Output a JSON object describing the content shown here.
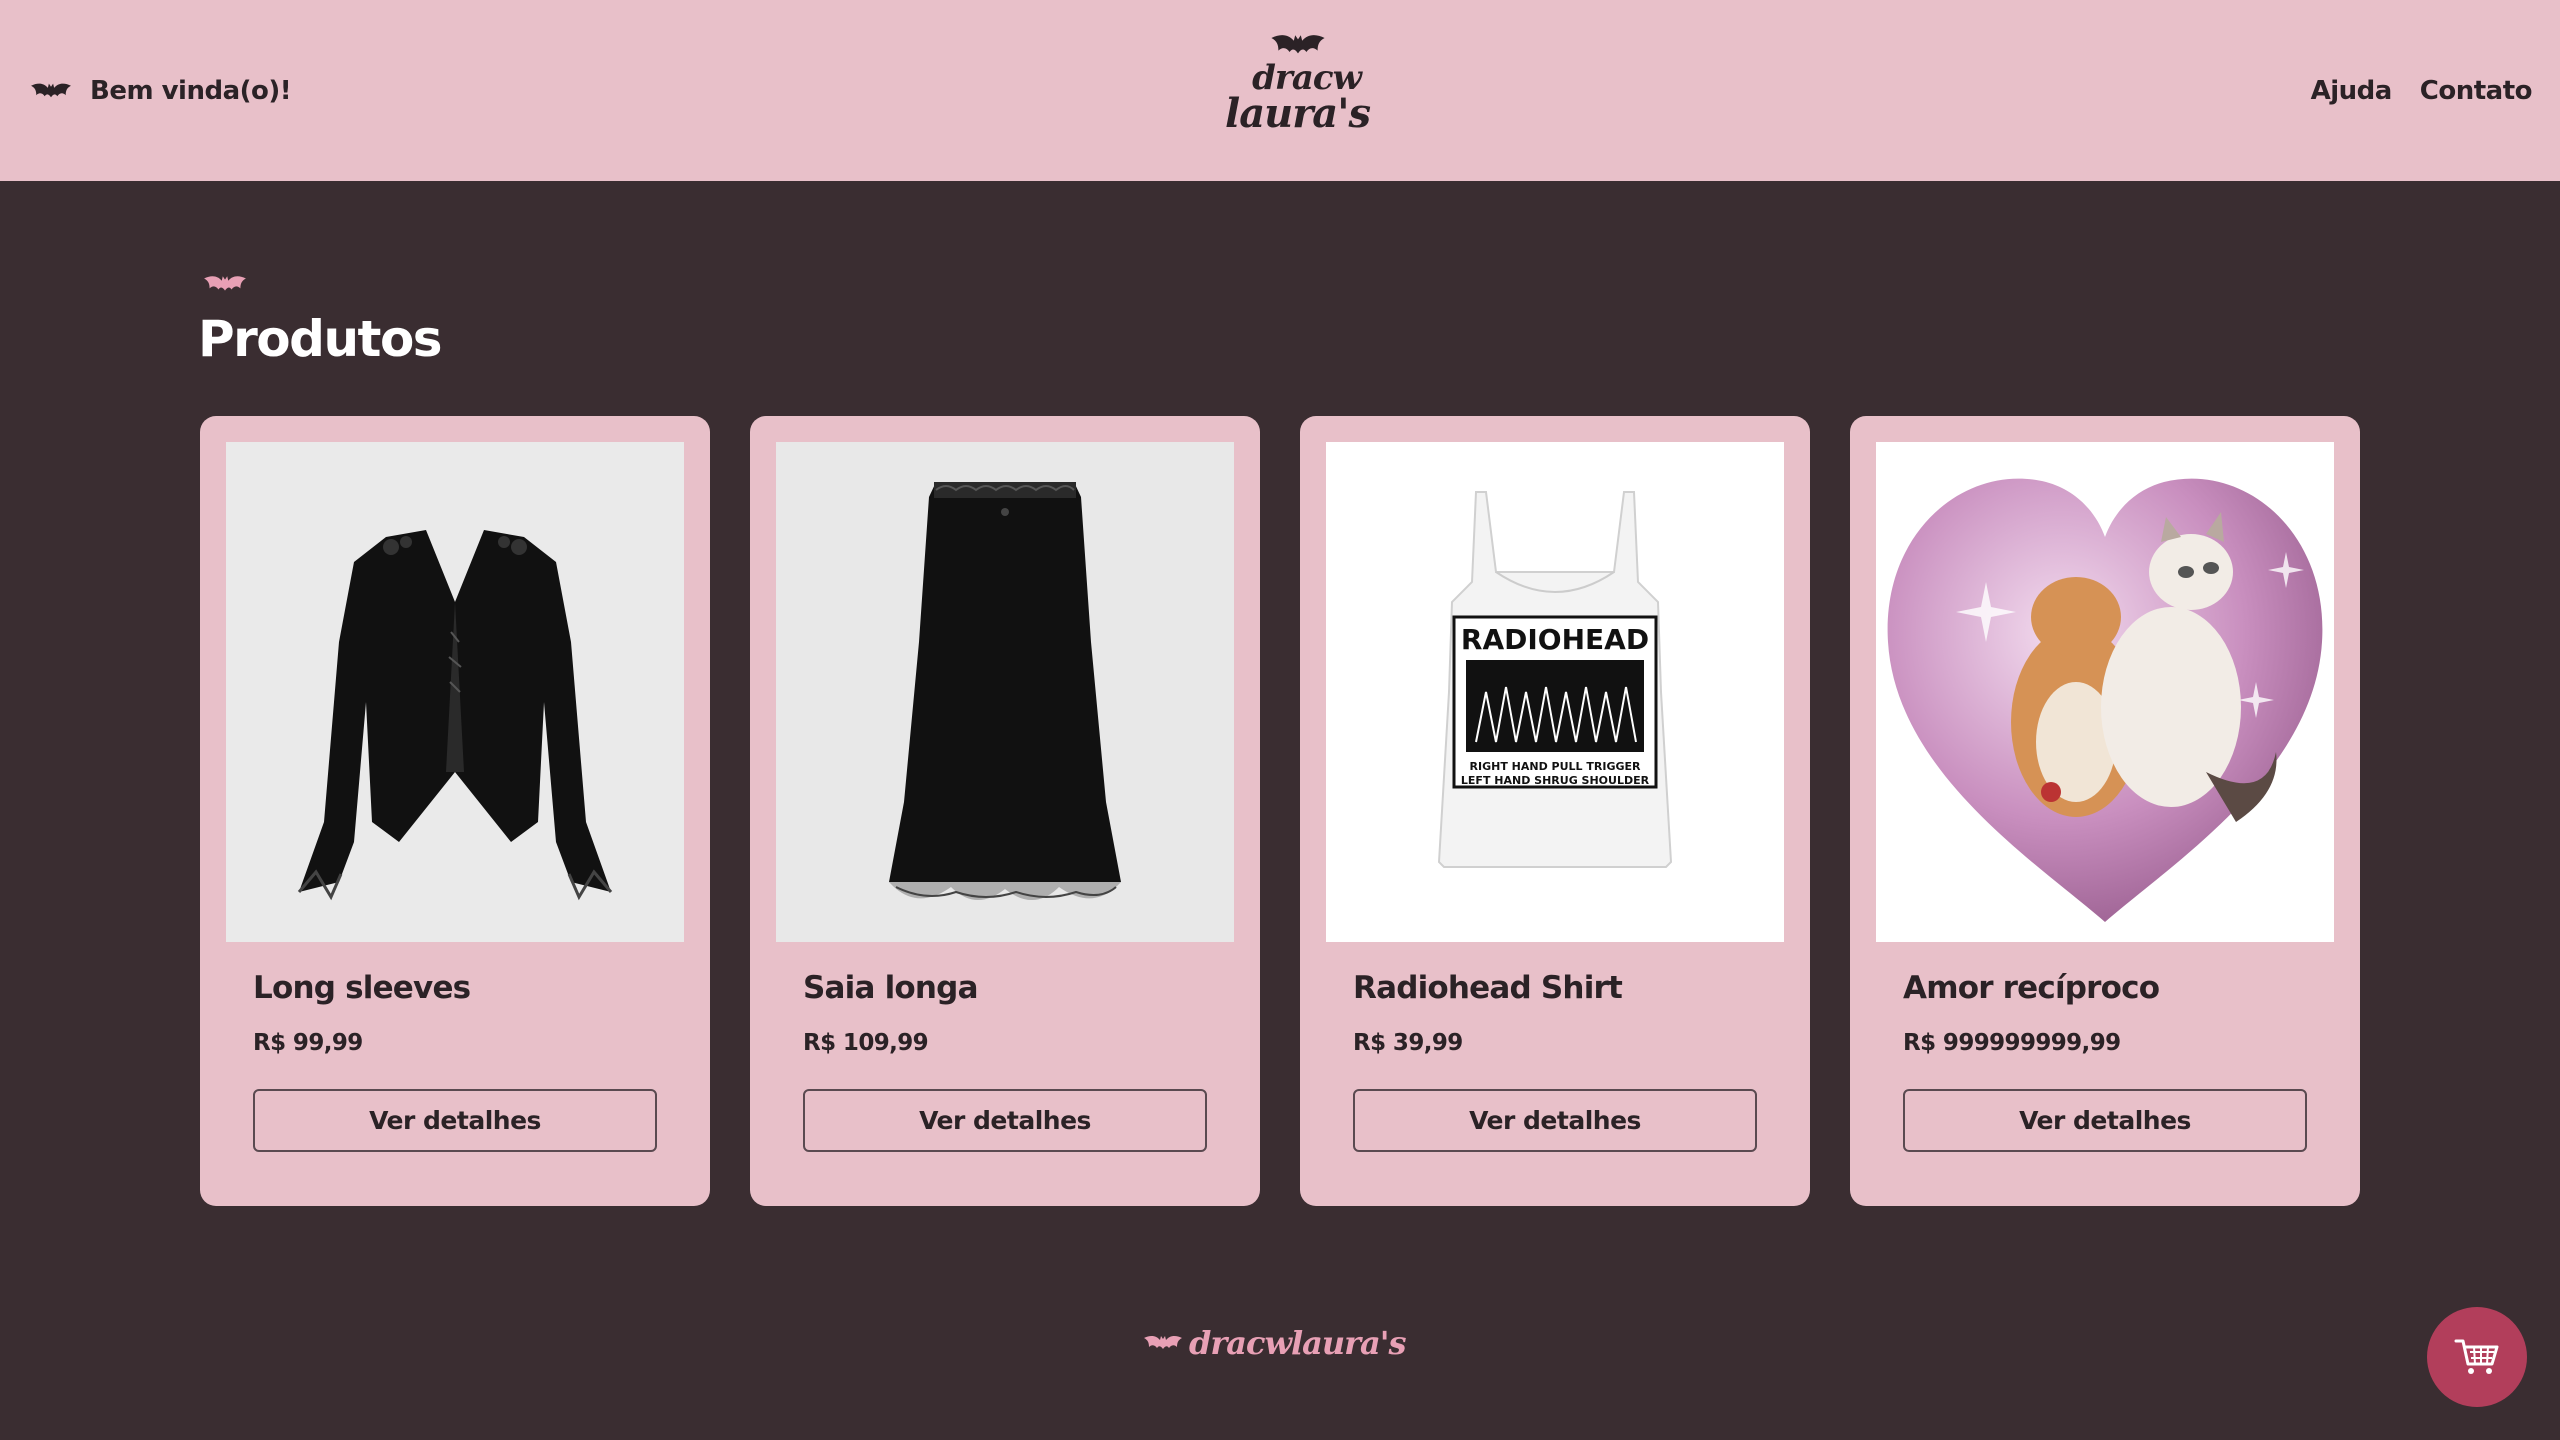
{
  "header": {
    "welcome": "Bem vinda(o)!",
    "logo_line1": "dracw",
    "logo_line2": "laura's",
    "nav": [
      {
        "label": "Ajuda"
      },
      {
        "label": "Contato"
      }
    ]
  },
  "section": {
    "title": "Produtos"
  },
  "products": [
    {
      "name": "Long sleeves",
      "price": "R$ 99,99",
      "button": "Ver detalhes"
    },
    {
      "name": "Saia longa",
      "price": "R$ 109,99",
      "button": "Ver detalhes"
    },
    {
      "name": "Radiohead Shirt",
      "price": "R$ 39,99",
      "button": "Ver detalhes"
    },
    {
      "name": "Amor recíproco",
      "price": "R$ 999999999,99",
      "button": "Ver detalhes"
    }
  ],
  "shirt_print": {
    "headline": "RADIOHEAD",
    "line1": "RIGHT HAND PULL TRIGGER",
    "line2": "LEFT HAND SHRUG SHOULDER"
  },
  "footer": {
    "logo": "dracwlaura's"
  },
  "icons": {
    "welcome": "bat-icon",
    "logo": "bat-icon",
    "section": "bat-icon",
    "footer": "bat-icon",
    "cart": "cart-icon"
  },
  "colors": {
    "header_bg": "#e8c0c9",
    "page_bg": "#3a2d31",
    "card_bg": "#e8c0c9",
    "accent_pink": "#e8a0b5",
    "cart_button": "#b23e5b"
  }
}
